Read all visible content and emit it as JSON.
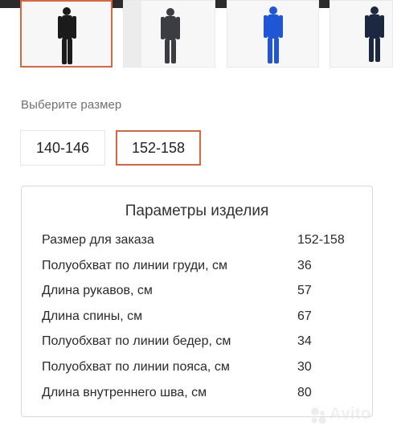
{
  "gallery": {
    "thumbnails": [
      {
        "name": "black-thermal-set",
        "color": "#1b1b1b",
        "selected": true
      },
      {
        "name": "gray-thermal-set",
        "color": "#3c3d42",
        "selected": false
      },
      {
        "name": "blue-thermal-set",
        "color": "#1e56d6",
        "selected": false
      },
      {
        "name": "navy-thermal-set",
        "color": "#1c2740",
        "selected": false
      }
    ]
  },
  "size_picker": {
    "label": "Выберите размер",
    "options": [
      {
        "label": "140-146",
        "selected": false
      },
      {
        "label": "152-158",
        "selected": true
      }
    ]
  },
  "params": {
    "title": "Параметры изделия",
    "rows": [
      {
        "name": "Размер для заказа",
        "value": "152-158"
      },
      {
        "name": "Полуобхват по линии груди, см",
        "value": "36"
      },
      {
        "name": "Длина рукавов, см",
        "value": "57"
      },
      {
        "name": "Длина спины, см",
        "value": "67"
      },
      {
        "name": "Полуобхват по линии бедер, см",
        "value": "34"
      },
      {
        "name": "Полуобхват по линии пояса, см",
        "value": "30"
      },
      {
        "name": "Длина внутреннего шва, см",
        "value": "80"
      }
    ]
  },
  "watermark": {
    "text": "Avito"
  },
  "colors": {
    "accent": "#d9663f",
    "top_accent": "#e8673a"
  }
}
